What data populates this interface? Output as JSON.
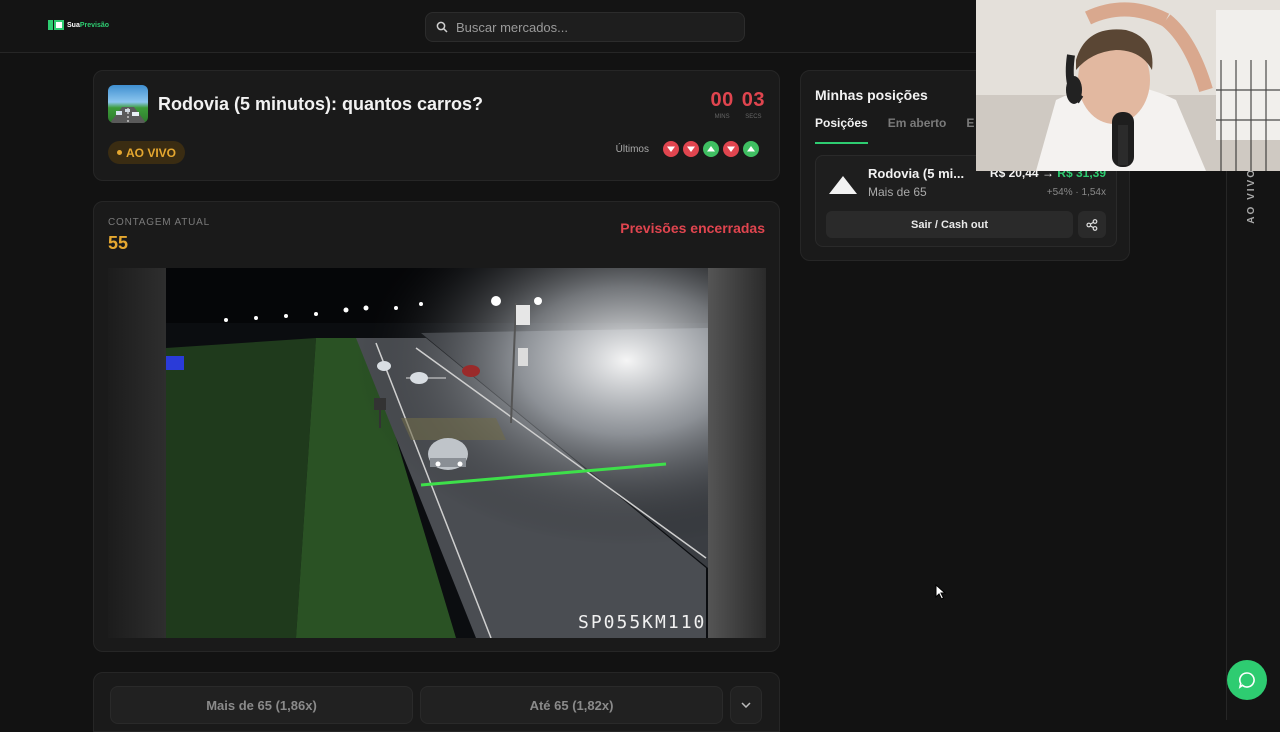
{
  "header": {
    "logo": {
      "prefix": "Sua",
      "suffix": "Previsão"
    },
    "search": {
      "placeholder": "Buscar mercados..."
    }
  },
  "market": {
    "title": "Rodovia (5 minutos): quantos carros?",
    "timer": {
      "minutes": "00",
      "minutes_label": "MINS",
      "seconds": "03",
      "seconds_label": "SECS"
    },
    "live_label": "AO VIVO",
    "recent_label": "Últimos",
    "recent_results": [
      "down",
      "down",
      "up",
      "down",
      "up"
    ]
  },
  "stream": {
    "count_label": "CONTAGEM ATUAL",
    "count_value": "55",
    "status": "Previsões encerradas",
    "camera_id": "SP055KM110"
  },
  "betting": {
    "more_label": "Mais de 65",
    "more_odds": "(1,86x)",
    "until_label": "Até 65",
    "until_odds": "(1,82x)"
  },
  "positions": {
    "title": "Minhas posições",
    "tabs": [
      "Posições",
      "Em aberto",
      "E"
    ],
    "active_tab": 0,
    "item": {
      "name": "Rodovia (5 mi...",
      "subtitle": "Mais de 65",
      "value_from": "R$ 20,44",
      "value_arrow": "→",
      "value_to": "R$ 31,39",
      "stats": "+54% · 1,54x",
      "cash_out_label": "Sair / Cash out"
    }
  },
  "right_rail": {
    "label": "AO VIVO"
  },
  "colors": {
    "accent_green": "#2ecc71",
    "live_orange": "#e6a830",
    "alert_red": "#e0454f",
    "background": "#121212",
    "card": "#1a1a1a"
  },
  "icons": {
    "search": "search-icon",
    "share": "share-icon",
    "chat": "chat-icon",
    "chevron": "chevron-down-icon",
    "up_triangle": "triangle-up-icon"
  }
}
